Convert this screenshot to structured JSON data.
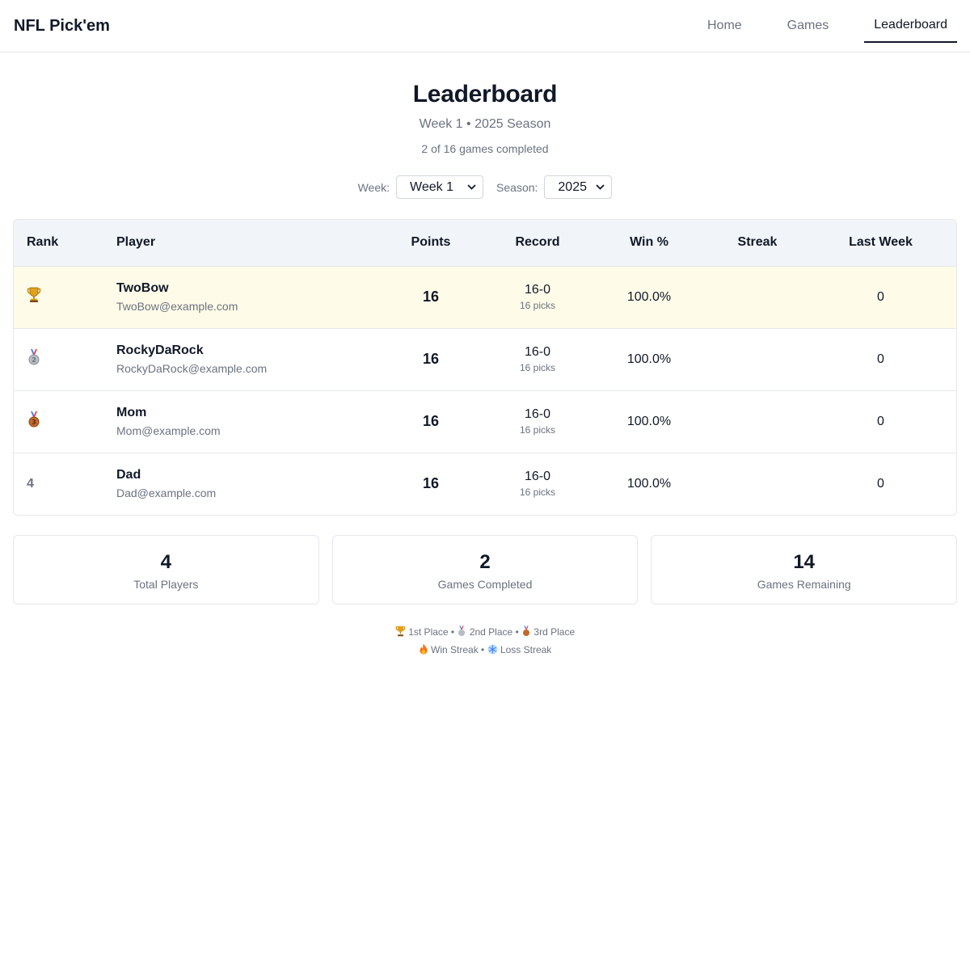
{
  "header": {
    "brand": "NFL Pick'em",
    "nav": [
      {
        "label": "Home",
        "active": false
      },
      {
        "label": "Games",
        "active": false
      },
      {
        "label": "Leaderboard",
        "active": true
      }
    ]
  },
  "page": {
    "title": "Leaderboard",
    "subtitle": "Week 1 • 2025 Season",
    "meta": "2 of 16 games completed"
  },
  "filters": {
    "week_label": "Week:",
    "week_value": "Week 1",
    "season_label": "Season:",
    "season_value": "2025"
  },
  "table": {
    "columns": [
      "Rank",
      "Player",
      "Points",
      "Record",
      "Win %",
      "Streak",
      "Last Week"
    ],
    "rows": [
      {
        "rank": "",
        "rank_icon": "trophy-icon",
        "name": "TwoBow",
        "email": "TwoBow@example.com",
        "points": "16",
        "record": "16-0",
        "picks": "16 picks",
        "win_pct": "100.0%",
        "streak": "",
        "last_week": "0"
      },
      {
        "rank": "",
        "rank_icon": "silver-medal-icon",
        "name": "RockyDaRock",
        "email": "RockyDaRock@example.com",
        "points": "16",
        "record": "16-0",
        "picks": "16 picks",
        "win_pct": "100.0%",
        "streak": "",
        "last_week": "0"
      },
      {
        "rank": "",
        "rank_icon": "bronze-medal-icon",
        "name": "Mom",
        "email": "Mom@example.com",
        "points": "16",
        "record": "16-0",
        "picks": "16 picks",
        "win_pct": "100.0%",
        "streak": "",
        "last_week": "0"
      },
      {
        "rank": "4",
        "rank_icon": "",
        "name": "Dad",
        "email": "Dad@example.com",
        "points": "16",
        "record": "16-0",
        "picks": "16 picks",
        "win_pct": "100.0%",
        "streak": "",
        "last_week": "0"
      }
    ]
  },
  "stats": [
    {
      "value": "4",
      "label": "Total Players"
    },
    {
      "value": "2",
      "label": "Games Completed"
    },
    {
      "value": "14",
      "label": "Games Remaining"
    }
  ],
  "legend": {
    "first": "1st Place",
    "second": "2nd Place",
    "third": "3rd Place",
    "sep": "•",
    "win_streak": "Win Streak",
    "loss_streak": "Loss Streak"
  },
  "colors": {
    "first_row_bg": "#fefce8",
    "header_bg": "#f1f5f9",
    "border": "#e5e7eb",
    "muted_text": "#6b7280",
    "gold": "#e0a21b",
    "silver": "#9ca3af",
    "bronze": "#b45309"
  }
}
